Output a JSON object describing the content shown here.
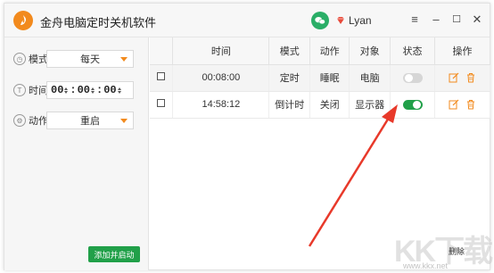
{
  "app": {
    "title": "金舟电脑定时关机软件",
    "user": "Lyan"
  },
  "window_controls": {
    "menu": "≡",
    "minimize": "–",
    "maximize": "☐",
    "close": "✕"
  },
  "form": {
    "mode_label": "模式",
    "mode_value": "每天",
    "time_label": "时间",
    "time_h": "00",
    "time_m": "00",
    "time_s": "00",
    "colon": ":",
    "action_label": "动作",
    "action_value": "重启",
    "add_button": "添加并启动"
  },
  "table": {
    "headers": [
      "",
      "时间",
      "模式",
      "动作",
      "对象",
      "状态",
      "操作"
    ],
    "rows": [
      {
        "time": "00:08:00",
        "mode": "定时",
        "action": "睡眠",
        "target": "电脑",
        "enabled": false
      },
      {
        "time": "14:58:12",
        "mode": "倒计时",
        "action": "关闭",
        "target": "显示器",
        "enabled": true
      }
    ]
  },
  "footer": {
    "delete_label": "删除"
  },
  "watermark": {
    "text": "KK下载",
    "url": "www.kkx.net"
  },
  "colors": {
    "accent_orange": "#f28a1d",
    "green": "#21a049",
    "wechat_green": "#2aae67",
    "arrow_red": "#e8392a"
  }
}
